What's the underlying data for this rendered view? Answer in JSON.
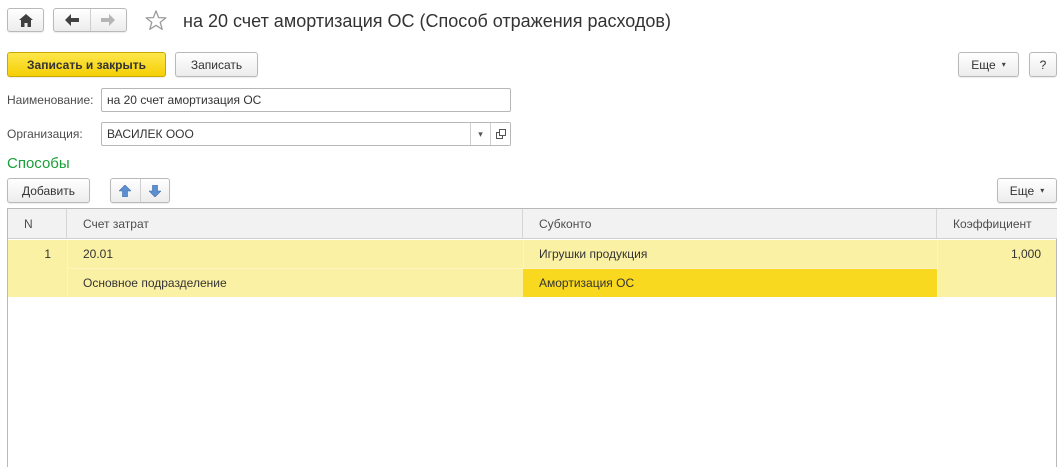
{
  "window": {
    "title": "на 20 счет амортизация ОС (Способ отражения расходов)"
  },
  "nav": {
    "home_icon": "home-icon",
    "back_icon": "arrow-left-icon",
    "forward_icon": "arrow-right-icon",
    "favorite_icon": "star-icon"
  },
  "toolbar": {
    "save_close_label": "Записать и закрыть",
    "save_label": "Записать",
    "more_label": "Еще",
    "help_label": "?"
  },
  "form": {
    "name_label": "Наименование:",
    "name_value": "на 20 счет амортизация ОС",
    "org_label": "Организация:",
    "org_value": "ВАСИЛЕК ООО"
  },
  "methods": {
    "section_title": "Способы",
    "add_label": "Добавить",
    "more_label": "Еще",
    "columns": [
      "N",
      "Счет затрат",
      "Субконто",
      "Коэффициент"
    ],
    "rows": [
      {
        "n": "1",
        "account": "20.01",
        "subconto1": "Игрушки продукция",
        "coef": "1,000",
        "department": "Основное подразделение",
        "subconto2": "Амортизация ОС"
      }
    ]
  },
  "colors": {
    "accent_green": "#1a9e3a",
    "primary_button": "#f5d21c",
    "row_highlight": "#fbf1a5",
    "selected_cell": "#f9d920"
  }
}
